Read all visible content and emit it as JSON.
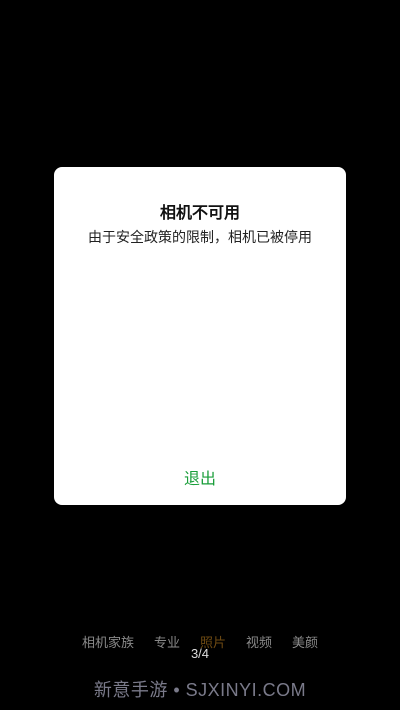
{
  "dialog": {
    "title": "相机不可用",
    "message": "由于安全政策的限制，相机已被停用",
    "exit_label": "退出",
    "exit_color": "#1a9e3a"
  },
  "mode_bar": {
    "items": [
      {
        "label": "相机家族"
      },
      {
        "label": "专业"
      },
      {
        "label": "照片"
      },
      {
        "label": "视频"
      },
      {
        "label": "美颜"
      }
    ],
    "active_index": 2,
    "active_color": "#6e4a12"
  },
  "page_indicator": "3/4",
  "watermark": "新意手游 • SJXINYI.COM",
  "colors": {
    "background": "#000000",
    "dialog_background": "#ffffff"
  }
}
